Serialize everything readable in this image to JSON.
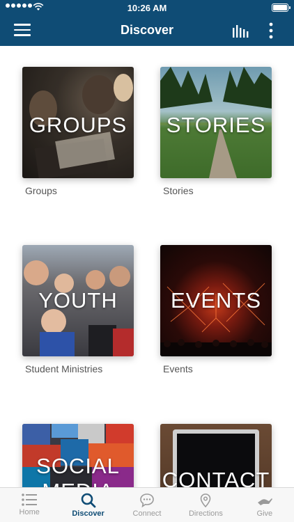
{
  "status_bar": {
    "time": "10:26 AM"
  },
  "navbar": {
    "title": "Discover"
  },
  "tiles": [
    {
      "overlay": "GROUPS",
      "caption": "Groups"
    },
    {
      "overlay": "STORIES",
      "caption": "Stories"
    },
    {
      "overlay": "YOUTH",
      "caption": "Student Ministries"
    },
    {
      "overlay": "EVENTS",
      "caption": "Events"
    },
    {
      "overlay": "SOCIAL MEDIA",
      "caption": ""
    },
    {
      "overlay": "CONTACT",
      "caption": ""
    }
  ],
  "tabbar": {
    "items": [
      {
        "label": "Home",
        "icon": "list-icon",
        "active": false
      },
      {
        "label": "Discover",
        "icon": "search-icon",
        "active": true
      },
      {
        "label": "Connect",
        "icon": "chat-icon",
        "active": false
      },
      {
        "label": "Directions",
        "icon": "pin-icon",
        "active": false
      },
      {
        "label": "Give",
        "icon": "hand-icon",
        "active": false
      }
    ]
  },
  "colors": {
    "brand": "#0f4c75",
    "inactive": "#9a9a9a"
  }
}
